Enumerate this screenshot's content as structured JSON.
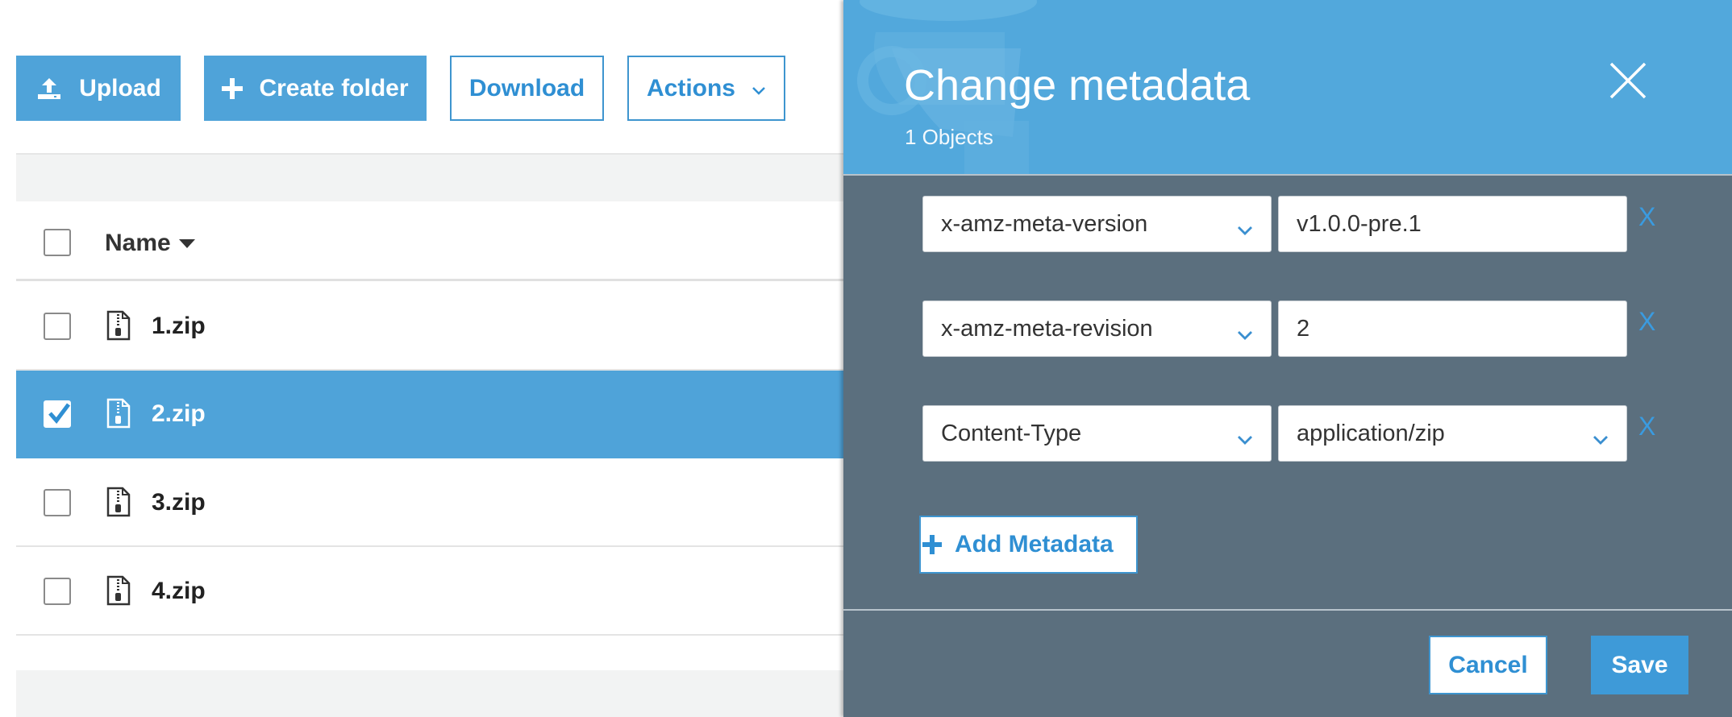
{
  "toolbar": {
    "upload_label": "Upload",
    "create_folder_label": "Create folder",
    "download_label": "Download",
    "actions_label": "Actions"
  },
  "table": {
    "name_header": "Name",
    "rows": [
      {
        "name": "1.zip",
        "selected": false
      },
      {
        "name": "2.zip",
        "selected": true
      },
      {
        "name": "3.zip",
        "selected": false
      },
      {
        "name": "4.zip",
        "selected": false
      }
    ]
  },
  "modal": {
    "title": "Change metadata",
    "subtitle": "1 Objects",
    "metadata": [
      {
        "key": "x-amz-meta-version",
        "value": "v1.0.0-pre.1",
        "value_is_select": false,
        "remove_label": "X"
      },
      {
        "key": "x-amz-meta-revision",
        "value": "2",
        "value_is_select": false,
        "remove_label": "X"
      },
      {
        "key": "Content-Type",
        "value": "application/zip",
        "value_is_select": true,
        "remove_label": "X"
      }
    ],
    "add_label": "Add Metadata",
    "cancel_label": "Cancel",
    "save_label": "Save"
  },
  "colors": {
    "accent": "#4fa3d9",
    "panel_body": "#5b6f7e",
    "link_blue": "#2f8fd3"
  },
  "icons": {
    "upload": "upload-icon",
    "create_folder": "plus-icon",
    "actions": "chevron-down-icon",
    "sort": "sort-down-icon",
    "file": "zip-file-icon",
    "close": "close-icon",
    "add": "plus-icon"
  }
}
